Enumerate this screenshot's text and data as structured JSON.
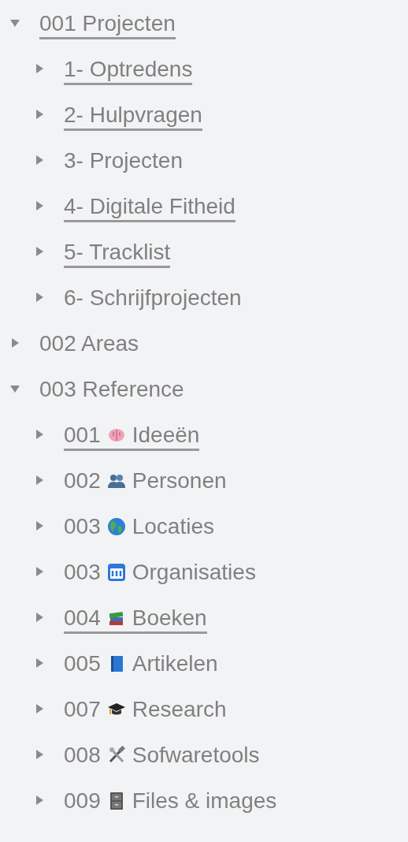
{
  "tree": [
    {
      "label": "001 Projecten",
      "underlined": true,
      "expanded": true,
      "children": [
        {
          "label": "1- Optredens",
          "underlined": true,
          "expanded": false
        },
        {
          "label": "2- Hulpvragen",
          "underlined": true,
          "expanded": false
        },
        {
          "label": "3- Projecten",
          "underlined": false,
          "expanded": false
        },
        {
          "label": "4- Digitale Fitheid",
          "underlined": true,
          "expanded": false
        },
        {
          "label": "5- Tracklist",
          "underlined": true,
          "expanded": false
        },
        {
          "label": "6- Schrijfprojecten",
          "underlined": false,
          "expanded": false
        }
      ]
    },
    {
      "label": "002 Areas",
      "underlined": false,
      "expanded": false
    },
    {
      "label": "003 Reference",
      "underlined": false,
      "expanded": true,
      "children": [
        {
          "number": "001",
          "kind": "brain",
          "name": "Ideeën",
          "underlined": true,
          "expanded": false
        },
        {
          "number": "002",
          "kind": "people",
          "name": "Personen",
          "underlined": false,
          "expanded": false
        },
        {
          "number": "003",
          "kind": "globe",
          "name": "Locaties",
          "underlined": false,
          "expanded": false
        },
        {
          "number": "003",
          "kind": "elevator",
          "name": "Organisaties",
          "underlined": false,
          "expanded": false
        },
        {
          "number": "004",
          "kind": "books",
          "name": "Boeken",
          "underlined": true,
          "expanded": false
        },
        {
          "number": "005",
          "kind": "book",
          "name": "Artikelen",
          "underlined": false,
          "expanded": false
        },
        {
          "number": "007",
          "kind": "cap",
          "name": "Research",
          "underlined": false,
          "expanded": false
        },
        {
          "number": "008",
          "kind": "tools",
          "name": "Sofwaretools",
          "underlined": false,
          "expanded": false
        },
        {
          "number": "009",
          "kind": "cabinet",
          "name": "Files & images",
          "underlined": false,
          "expanded": false
        }
      ]
    }
  ]
}
